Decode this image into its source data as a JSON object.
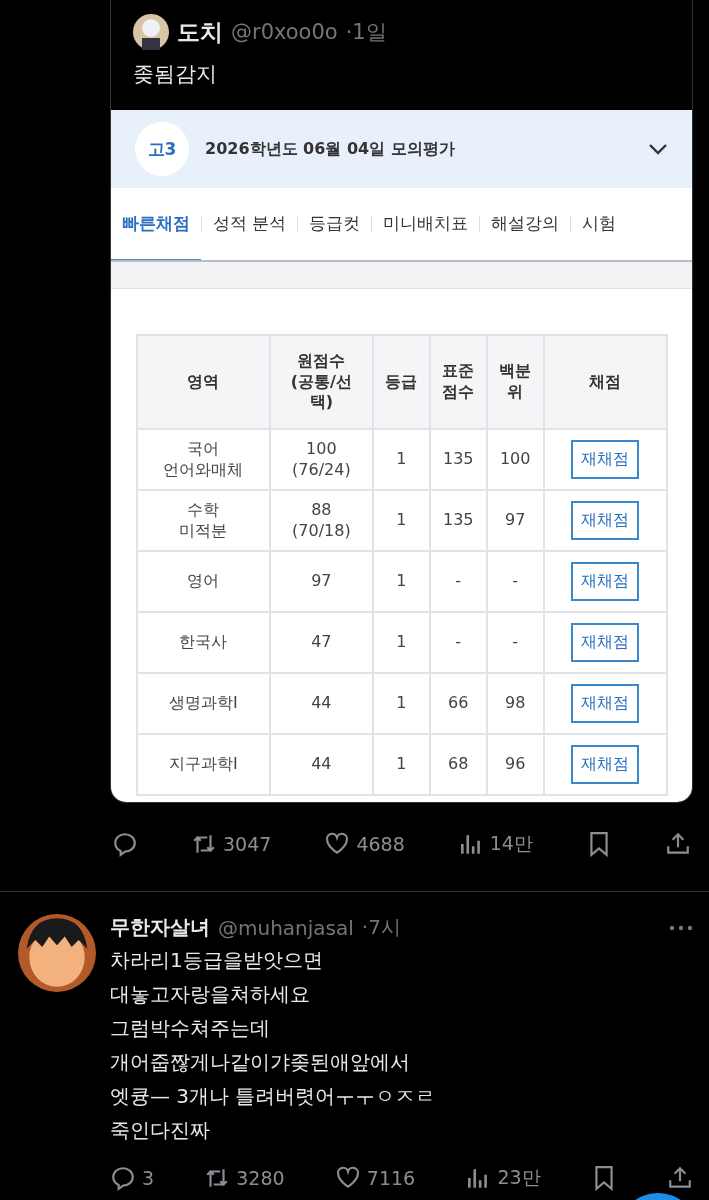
{
  "quoted_tweet": {
    "name": "도치",
    "handle": "@r0xoo0o",
    "time": "·1일",
    "text": "좆됨감지",
    "screenshot": {
      "grade_badge": "고3",
      "exam_title": "2026학년도 06월 04일 모의평가",
      "tabs": [
        {
          "label": "빠른채점",
          "selected": true
        },
        {
          "label": "성적 분석",
          "selected": false
        },
        {
          "label": "등급컷",
          "selected": false
        },
        {
          "label": "미니배치표",
          "selected": false
        },
        {
          "label": "해설강의",
          "selected": false
        },
        {
          "label": "시험",
          "selected": false
        }
      ],
      "table": {
        "columns": [
          "영역",
          "원점수\n(공통/선\n택)",
          "등급",
          "표준\n점수",
          "백분\n위",
          "채점"
        ],
        "rows": [
          {
            "subject": "국어\n언어와매체",
            "raw": "100\n(76/24)",
            "grade": "1",
            "standard": "135",
            "percentile": "100",
            "action": "재채점"
          },
          {
            "subject": "수학\n미적분",
            "raw": "88\n(70/18)",
            "grade": "1",
            "standard": "135",
            "percentile": "97",
            "action": "재채점"
          },
          {
            "subject": "영어",
            "raw": "97",
            "grade": "1",
            "standard": "-",
            "percentile": "-",
            "action": "재채점"
          },
          {
            "subject": "한국사",
            "raw": "47",
            "grade": "1",
            "standard": "-",
            "percentile": "-",
            "action": "재채점"
          },
          {
            "subject": "생명과학Ⅰ",
            "raw": "44",
            "grade": "1",
            "standard": "66",
            "percentile": "98",
            "action": "재채점"
          },
          {
            "subject": "지구과학Ⅰ",
            "raw": "44",
            "grade": "1",
            "standard": "68",
            "percentile": "96",
            "action": "재채점"
          }
        ]
      }
    }
  },
  "main_actions": {
    "retweets": "3047",
    "likes": "4688",
    "views": "14만"
  },
  "reply": {
    "name": "무한자살녀",
    "handle": "@muhanjasal",
    "time": "·7시",
    "lines": [
      "차라리1등급을받앗으면",
      "대놓고자랑을쳐하세요",
      "그럼박수쳐주는데",
      "개어줍짢게나같이갸좆된애앞에서",
      "엣큥— 3개나 틀려버렷어ㅜㅜㅇㅈㄹ",
      "죽인다진짜"
    ],
    "actions": {
      "replies": "3",
      "retweets": "3280",
      "likes": "7116",
      "views": "23만"
    }
  }
}
